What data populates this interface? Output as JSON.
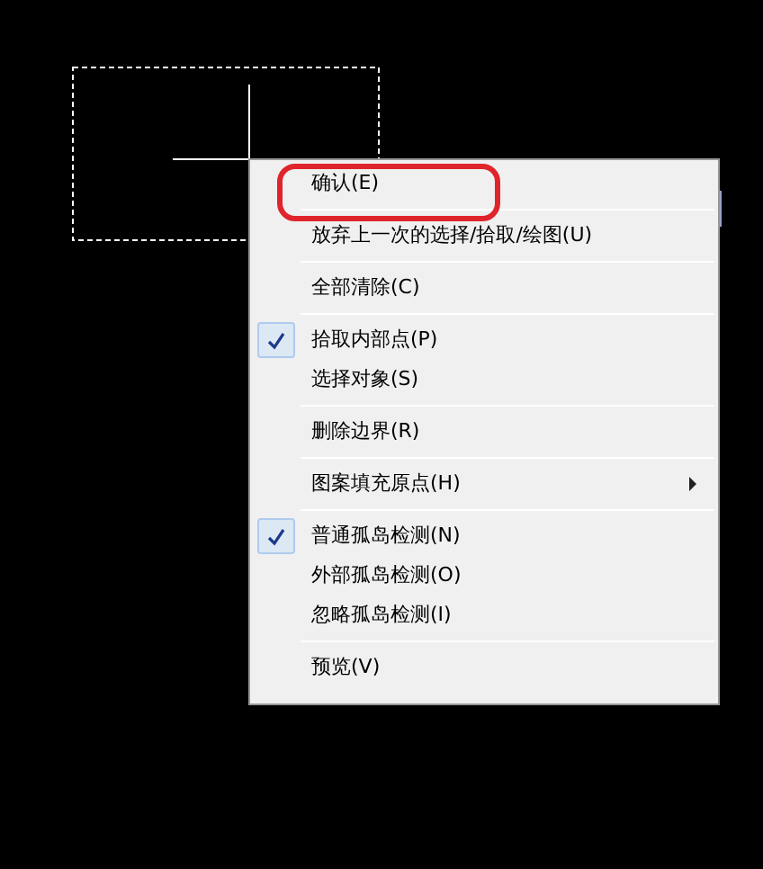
{
  "context_menu": {
    "groups": [
      {
        "items": [
          {
            "label": "确认(E)",
            "checked": false,
            "highlighted": true
          }
        ]
      },
      {
        "items": [
          {
            "label": "放弃上一次的选择/拾取/绘图(U)",
            "checked": false
          }
        ]
      },
      {
        "items": [
          {
            "label": "全部清除(C)",
            "checked": false
          }
        ]
      },
      {
        "items": [
          {
            "label": "拾取内部点(P)",
            "checked": true
          },
          {
            "label": "选择对象(S)",
            "checked": false
          }
        ]
      },
      {
        "items": [
          {
            "label": "删除边界(R)",
            "checked": false
          }
        ]
      },
      {
        "items": [
          {
            "label": "图案填充原点(H)",
            "checked": false,
            "submenu": true
          }
        ]
      },
      {
        "items": [
          {
            "label": "普通孤岛检测(N)",
            "checked": true
          },
          {
            "label": "外部孤岛检测(O)",
            "checked": false
          },
          {
            "label": "忽略孤岛检测(I)",
            "checked": false
          }
        ]
      },
      {
        "items": [
          {
            "label": "预览(V)",
            "checked": false
          }
        ]
      }
    ]
  }
}
